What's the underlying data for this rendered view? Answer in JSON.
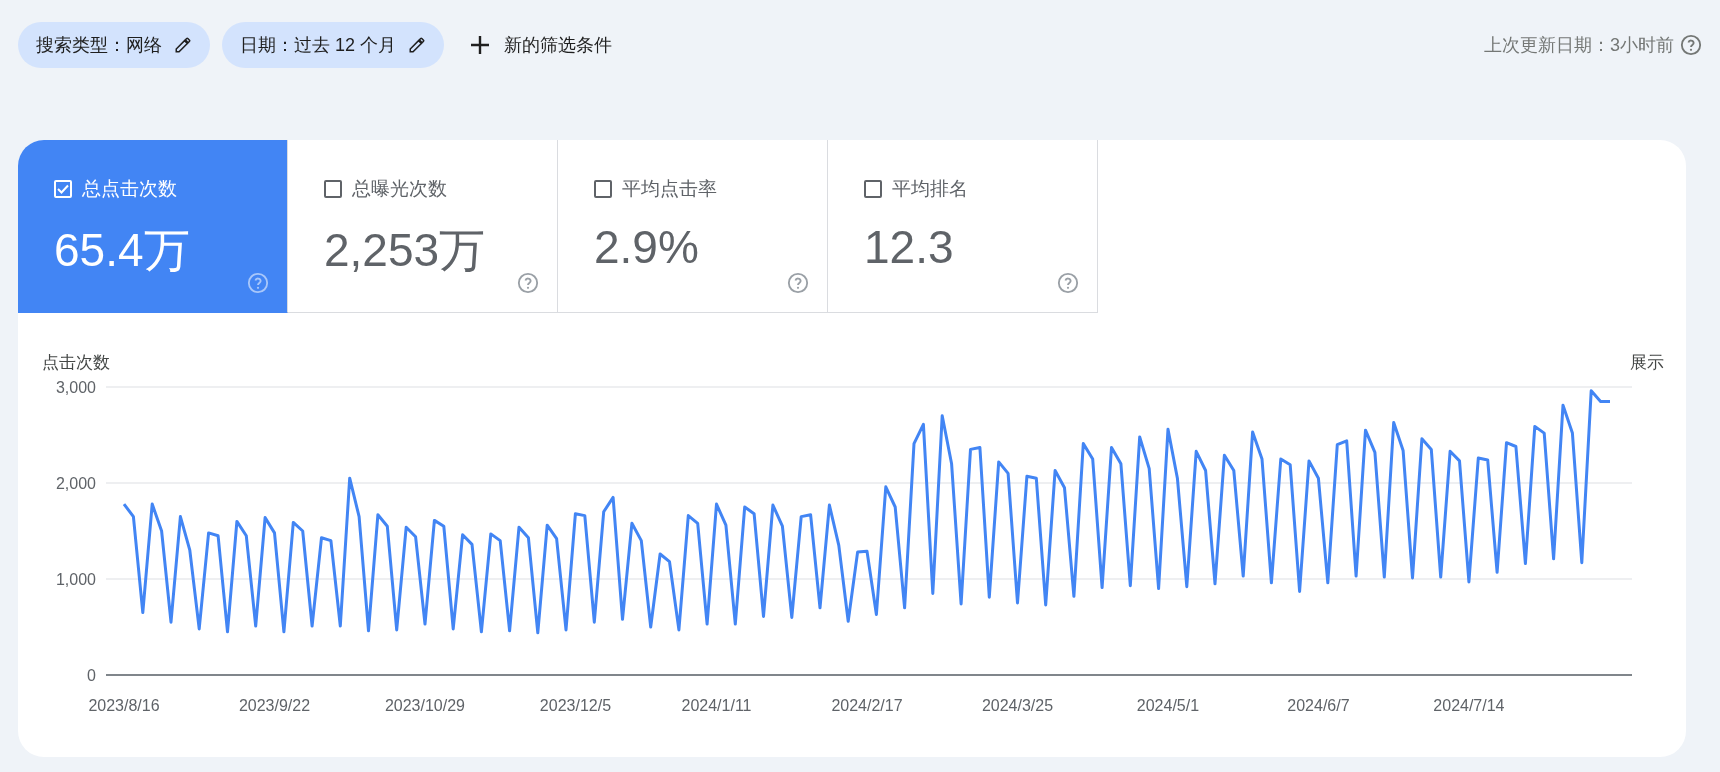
{
  "filters": [
    {
      "label": "搜索类型：网络"
    },
    {
      "label": "日期：过去 12 个月"
    }
  ],
  "new_filter": {
    "label": "新的筛选条件"
  },
  "last_updated": "上次更新日期：3小时前",
  "metrics": [
    {
      "label": "总点击次数",
      "value": "65.4万",
      "checked": true
    },
    {
      "label": "总曝光次数",
      "value": "2,253万",
      "checked": false
    },
    {
      "label": "平均点击率",
      "value": "2.9%",
      "checked": false
    },
    {
      "label": "平均排名",
      "value": "12.3",
      "checked": false
    }
  ],
  "chart": {
    "right_label": "展示",
    "chart_data": {
      "type": "line",
      "ylabel": "点击次数",
      "ylim": [
        0,
        3000
      ],
      "yticks": [
        {
          "value": 0,
          "label": "0"
        },
        {
          "value": 1000,
          "label": "1,000"
        },
        {
          "value": 2000,
          "label": "2,000"
        },
        {
          "value": 3000,
          "label": "3,000"
        }
      ],
      "categories": [
        "2023/8/16",
        null,
        null,
        null,
        null,
        null,
        null,
        null,
        null,
        null,
        null,
        null,
        null,
        null,
        null,
        null,
        "2023/9/22",
        null,
        null,
        null,
        null,
        null,
        null,
        null,
        null,
        null,
        null,
        null,
        null,
        null,
        null,
        null,
        "2023/10/29",
        null,
        null,
        null,
        null,
        null,
        null,
        null,
        null,
        null,
        null,
        null,
        null,
        null,
        null,
        null,
        "2023/12/5",
        null,
        null,
        null,
        null,
        null,
        null,
        null,
        null,
        null,
        null,
        null,
        null,
        null,
        null,
        "2024/1/11",
        null,
        null,
        null,
        null,
        null,
        null,
        null,
        null,
        null,
        null,
        null,
        null,
        null,
        null,
        null,
        "2024/2/17",
        null,
        null,
        null,
        null,
        null,
        null,
        null,
        null,
        null,
        null,
        null,
        null,
        null,
        null,
        null,
        "2024/3/25",
        null,
        null,
        null,
        null,
        null,
        null,
        null,
        null,
        null,
        null,
        null,
        null,
        null,
        null,
        null,
        "2024/5/1",
        null,
        null,
        null,
        null,
        null,
        null,
        null,
        null,
        null,
        null,
        null,
        null,
        null,
        null,
        null,
        "2024/6/7",
        null,
        null,
        null,
        null,
        null,
        null,
        null,
        null,
        null,
        null,
        null,
        null,
        null,
        null,
        null,
        "2024/7/14",
        null,
        null,
        null,
        null,
        null,
        null,
        null,
        null,
        null,
        null,
        null,
        null,
        null,
        null,
        null
      ],
      "series": [
        {
          "color": "#4285f4",
          "values": [
            1780,
            1650,
            650,
            1780,
            1500,
            550,
            1650,
            1300,
            480,
            1480,
            1450,
            450,
            1600,
            1450,
            510,
            1640,
            1480,
            450,
            1590,
            1500,
            510,
            1430,
            1400,
            510,
            2050,
            1650,
            460,
            1670,
            1550,
            470,
            1540,
            1440,
            530,
            1610,
            1550,
            480,
            1460,
            1360,
            450,
            1470,
            1400,
            460,
            1540,
            1430,
            440,
            1560,
            1420,
            470,
            1680,
            1660,
            550,
            1700,
            1850,
            580,
            1580,
            1400,
            500,
            1260,
            1180,
            470,
            1660,
            1580,
            530,
            1780,
            1560,
            530,
            1750,
            1680,
            610,
            1770,
            1550,
            600,
            1650,
            1670,
            700,
            1770,
            1350,
            560,
            1280,
            1290,
            630,
            1960,
            1750,
            700,
            2410,
            2610,
            850,
            2700,
            2200,
            740,
            2350,
            2370,
            810,
            2220,
            2100,
            750,
            2070,
            2050,
            730,
            2130,
            1950,
            820,
            2410,
            2250,
            910,
            2370,
            2200,
            930,
            2480,
            2150,
            900,
            2560,
            2050,
            920,
            2330,
            2130,
            950,
            2290,
            2130,
            1030,
            2530,
            2250,
            960,
            2250,
            2190,
            870,
            2230,
            2050,
            960,
            2400,
            2440,
            1030,
            2550,
            2320,
            1020,
            2630,
            2340,
            1010,
            2460,
            2350,
            1020,
            2330,
            2230,
            970,
            2260,
            2240,
            1070,
            2420,
            2380,
            1160,
            2590,
            2520,
            1210,
            2810,
            2520,
            1170,
            2960,
            2850,
            2850
          ]
        }
      ]
    }
  }
}
